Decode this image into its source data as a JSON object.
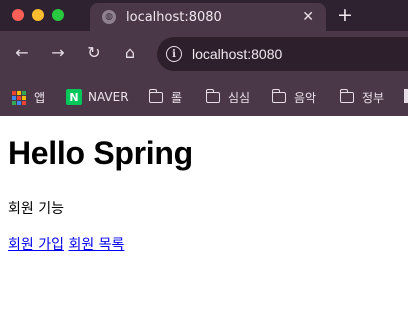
{
  "browser": {
    "tab_title": "localhost:8080",
    "url": "localhost:8080",
    "new_tab_symbol": "+",
    "close_symbol": "✕",
    "bookmarks": [
      {
        "label": "앱",
        "icon": "apps-grid-icon"
      },
      {
        "label": "NAVER",
        "icon": "naver-logo-icon"
      },
      {
        "label": "롤",
        "icon": "folder-icon"
      },
      {
        "label": "심심",
        "icon": "folder-icon"
      },
      {
        "label": "음악",
        "icon": "folder-icon"
      },
      {
        "label": "정부",
        "icon": "folder-icon"
      }
    ],
    "colors": {
      "frame": "#3a2b3a",
      "toolbar": "#4a3849",
      "link": "#0000ee"
    }
  },
  "page": {
    "heading": "Hello Spring",
    "feature_label": "회원 기능",
    "links": [
      {
        "label": "회원 가입"
      },
      {
        "label": "회원 목록"
      }
    ]
  }
}
